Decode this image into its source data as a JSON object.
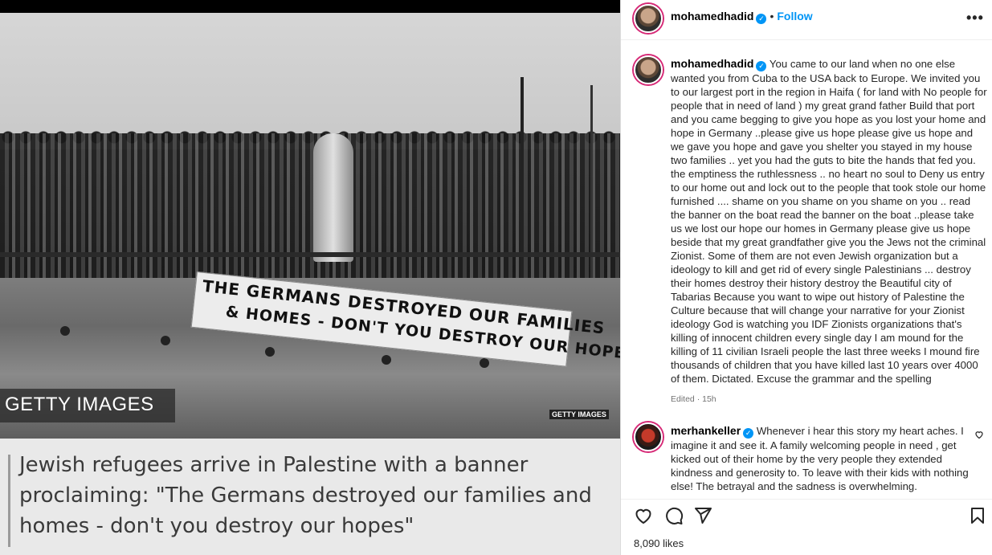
{
  "post": {
    "image": {
      "banner_line1": "THE GERMANS DESTROYED OUR FAMILIES",
      "banner_line2": "& HOMES - DON'T YOU DESTROY OUR HOPES",
      "getty_large": "GETTY IMAGES",
      "getty_small": "GETTY IMAGES",
      "caption": "Jewish refugees arrive in Palestine with a banner proclaiming: \"The Germans destroyed our families and homes - don't you destroy our hopes\""
    },
    "header": {
      "username": "mohamedhadid",
      "separator": "•",
      "follow_label": "Follow",
      "more_label": "•••",
      "verified_mark": "✓"
    },
    "caption": {
      "username": "mohamedhadid",
      "text": "You came to our land when no one else wanted you from Cuba to the USA back to Europe. We invited you to our largest port in the region in Haifa ( for land with No people for people that in need of land ) my great grand father Build that port and you came begging to give you hope as you lost your home and hope in Germany ..please give us hope please give us hope and we gave you hope and gave you shelter you stayed in my house two families .. yet you had the guts to bite the hands that fed you. the emptiness the ruthlessness .. no heart no soul to Deny us entry to our home out and lock out to the people that took stole our home furnished .... shame on you shame on you shame on you .. read the banner on the boat read the banner on the boat ..please take us we lost our hope our homes in Germany please give us hope beside that my great grandfather give you the Jews not the criminal Zionist. Some of them are not even Jewish organization but a ideology to kill and get rid of every single Palestinians ... destroy their homes destroy their history destroy the Beautiful city of Tabarias Because you want to wipe out history of Palestine the Culture because that will change your narrative for your Zionist ideology God is watching you IDF Zionists organizations that's killing of innocent children every single day I am mound for the killing of 11 civilian Israeli people the last three weeks I mound fire thousands of children that you have killed last 10 years over 4000 of them. Dictated. Excuse the grammar and the spelling",
      "meta": "Edited · 15h"
    },
    "comment": {
      "username": "merhankeller",
      "text": "Whenever i hear this story my heart aches. I imagine it and see it. A family welcoming people in need , get kicked out of their home by the very people they extended kindness and generosity to. To leave with their kids with nothing else! The betrayal and the sadness is overwhelming."
    },
    "actions": {
      "likes": "8,090 likes",
      "icons": [
        "heart-icon",
        "comment-icon",
        "share-icon",
        "bookmark-icon"
      ]
    }
  },
  "colors": {
    "link_blue": "#0095f6",
    "verified_blue": "#0095f6",
    "text": "#262626",
    "muted": "#737373",
    "story_ring": "#d62976"
  }
}
